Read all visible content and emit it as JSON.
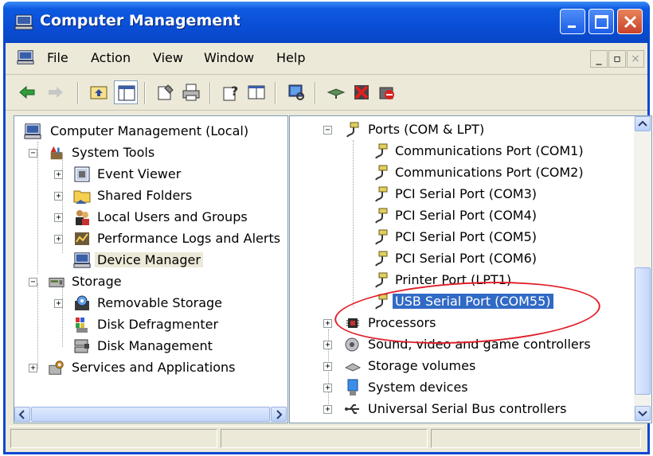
{
  "window": {
    "title": "Computer Management"
  },
  "menu": [
    "File",
    "Action",
    "View",
    "Window",
    "Help"
  ],
  "mdi_buttons": [
    "_",
    "▫",
    "×"
  ],
  "toolbar": {
    "icons": [
      "back-icon",
      "forward-icon",
      "up-folder-icon",
      "show-hide-tree-icon",
      "properties-icon",
      "print-icon",
      "help-icon",
      "export-icon",
      "scan-hardware-icon",
      "update-driver-icon",
      "disable-icon",
      "uninstall-icon"
    ]
  },
  "left_tree": [
    {
      "label": "Computer Management (Local)",
      "level": 0,
      "expander": "none",
      "icon": "computer-icon"
    },
    {
      "label": "System Tools",
      "level": 1,
      "expander": "minus",
      "icon": "tools-icon"
    },
    {
      "label": "Event Viewer",
      "level": 2,
      "expander": "plus",
      "icon": "event-viewer-icon"
    },
    {
      "label": "Shared Folders",
      "level": 2,
      "expander": "plus",
      "icon": "shared-folder-icon"
    },
    {
      "label": "Local Users and Groups",
      "level": 2,
      "expander": "plus",
      "icon": "users-icon"
    },
    {
      "label": "Performance Logs and Alerts",
      "level": 2,
      "expander": "plus",
      "icon": "performance-icon"
    },
    {
      "label": "Device Manager",
      "level": 2,
      "expander": "none",
      "icon": "device-manager-icon",
      "selected": true
    },
    {
      "label": "Storage",
      "level": 1,
      "expander": "minus",
      "icon": "storage-icon"
    },
    {
      "label": "Removable Storage",
      "level": 2,
      "expander": "plus",
      "icon": "removable-storage-icon"
    },
    {
      "label": "Disk Defragmenter",
      "level": 2,
      "expander": "none",
      "icon": "defragmenter-icon"
    },
    {
      "label": "Disk Management",
      "level": 2,
      "expander": "none",
      "icon": "disk-management-icon"
    },
    {
      "label": "Services and Applications",
      "level": 1,
      "expander": "plus",
      "icon": "services-icon"
    }
  ],
  "right_tree": [
    {
      "label": "Ports (COM & LPT)",
      "level": 0,
      "expander": "minus",
      "icon": "port-icon"
    },
    {
      "label": "Communications Port (COM1)",
      "level": 1,
      "expander": "none",
      "icon": "port-icon"
    },
    {
      "label": "Communications Port (COM2)",
      "level": 1,
      "expander": "none",
      "icon": "port-icon"
    },
    {
      "label": "PCI Serial Port (COM3)",
      "level": 1,
      "expander": "none",
      "icon": "port-icon"
    },
    {
      "label": "PCI Serial Port (COM4)",
      "level": 1,
      "expander": "none",
      "icon": "port-icon"
    },
    {
      "label": "PCI Serial Port (COM5)",
      "level": 1,
      "expander": "none",
      "icon": "port-icon"
    },
    {
      "label": "PCI Serial Port (COM6)",
      "level": 1,
      "expander": "none",
      "icon": "port-icon"
    },
    {
      "label": "Printer Port (LPT1)",
      "level": 1,
      "expander": "none",
      "icon": "port-icon"
    },
    {
      "label": "USB Serial Port (COM55)",
      "level": 1,
      "expander": "none",
      "icon": "port-icon",
      "selected": true
    },
    {
      "label": "Processors",
      "level": 0,
      "expander": "plus",
      "icon": "processor-icon"
    },
    {
      "label": "Sound, video and game controllers",
      "level": 0,
      "expander": "plus",
      "icon": "sound-icon"
    },
    {
      "label": "Storage volumes",
      "level": 0,
      "expander": "plus",
      "icon": "storage-volume-icon"
    },
    {
      "label": "System devices",
      "level": 0,
      "expander": "plus",
      "icon": "system-devices-icon"
    },
    {
      "label": "Universal Serial Bus controllers",
      "level": 0,
      "expander": "plus",
      "icon": "usb-icon"
    }
  ],
  "colors": {
    "selection": "#316ac5",
    "title_bar": "#0a4ed6",
    "annotation": "#e0202a"
  }
}
